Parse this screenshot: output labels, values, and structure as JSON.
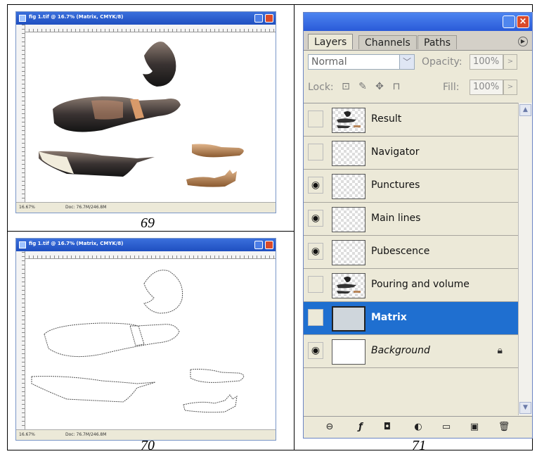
{
  "captions": {
    "fig69": "69",
    "fig70": "70",
    "fig71": "71"
  },
  "doc1": {
    "title": "fig 1.tif @ 16.7% (Matrix, CMYK/8)",
    "zoom": "16.67%",
    "doc_size": "Doc: 76.7M/246.8M"
  },
  "doc2": {
    "title": "fig 1.tif @ 16.7% (Matrix, CMYK/8)",
    "zoom": "16.67%",
    "doc_size": "Doc: 76.7M/246.8M"
  },
  "panel": {
    "tabs": [
      {
        "label": "Layers"
      },
      {
        "label": "Channels"
      },
      {
        "label": "Paths"
      }
    ],
    "blend_mode": "Normal",
    "opacity_label": "Opacity:",
    "opacity_value": "100%",
    "lock_label": "Lock:",
    "fill_label": "Fill:",
    "fill_value": "100%",
    "layers": [
      {
        "name": "Result",
        "visible": false
      },
      {
        "name": "Navigator",
        "visible": false
      },
      {
        "name": "Punctures",
        "visible": true
      },
      {
        "name": "Main lines",
        "visible": true
      },
      {
        "name": "Pubescence",
        "visible": true
      },
      {
        "name": "Pouring and volume",
        "visible": false
      },
      {
        "name": "Matrix",
        "visible": false,
        "selected": true
      },
      {
        "name": "Background",
        "visible": true,
        "locked": true
      }
    ]
  },
  "colors": {
    "title_blue": "#2a5ad8",
    "selection_blue": "#1f6fd0",
    "close_red": "#d94a2a"
  }
}
